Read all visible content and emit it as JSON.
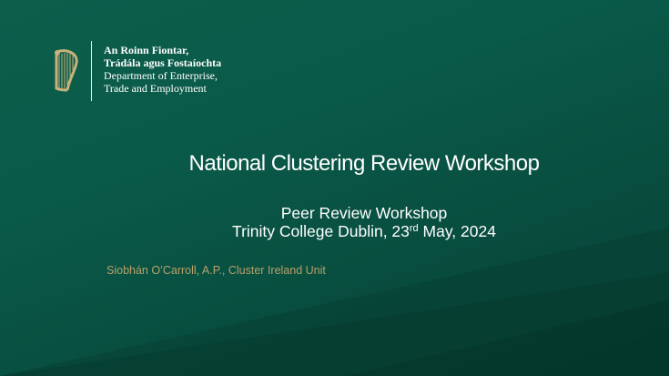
{
  "logo": {
    "icon": "harp-icon",
    "irish_line1": "An Roinn Fiontar,",
    "irish_line2": "Trádála agus Fostaíochta",
    "english_line1": "Department of Enterprise,",
    "english_line2": "Trade and Employment"
  },
  "slide": {
    "title": "National Clustering Review Workshop",
    "subtitle": "Peer Review Workshop",
    "venue_date_prefix": "Trinity College Dublin, 23",
    "venue_date_sup": "rd",
    "venue_date_suffix": " May, 2024",
    "presenter": "Siobhán O’Carroll, A.P., Cluster Ireland Unit"
  },
  "colors": {
    "background": "#0a5a49",
    "text": "#ffffff",
    "accent": "#b9a06a"
  }
}
